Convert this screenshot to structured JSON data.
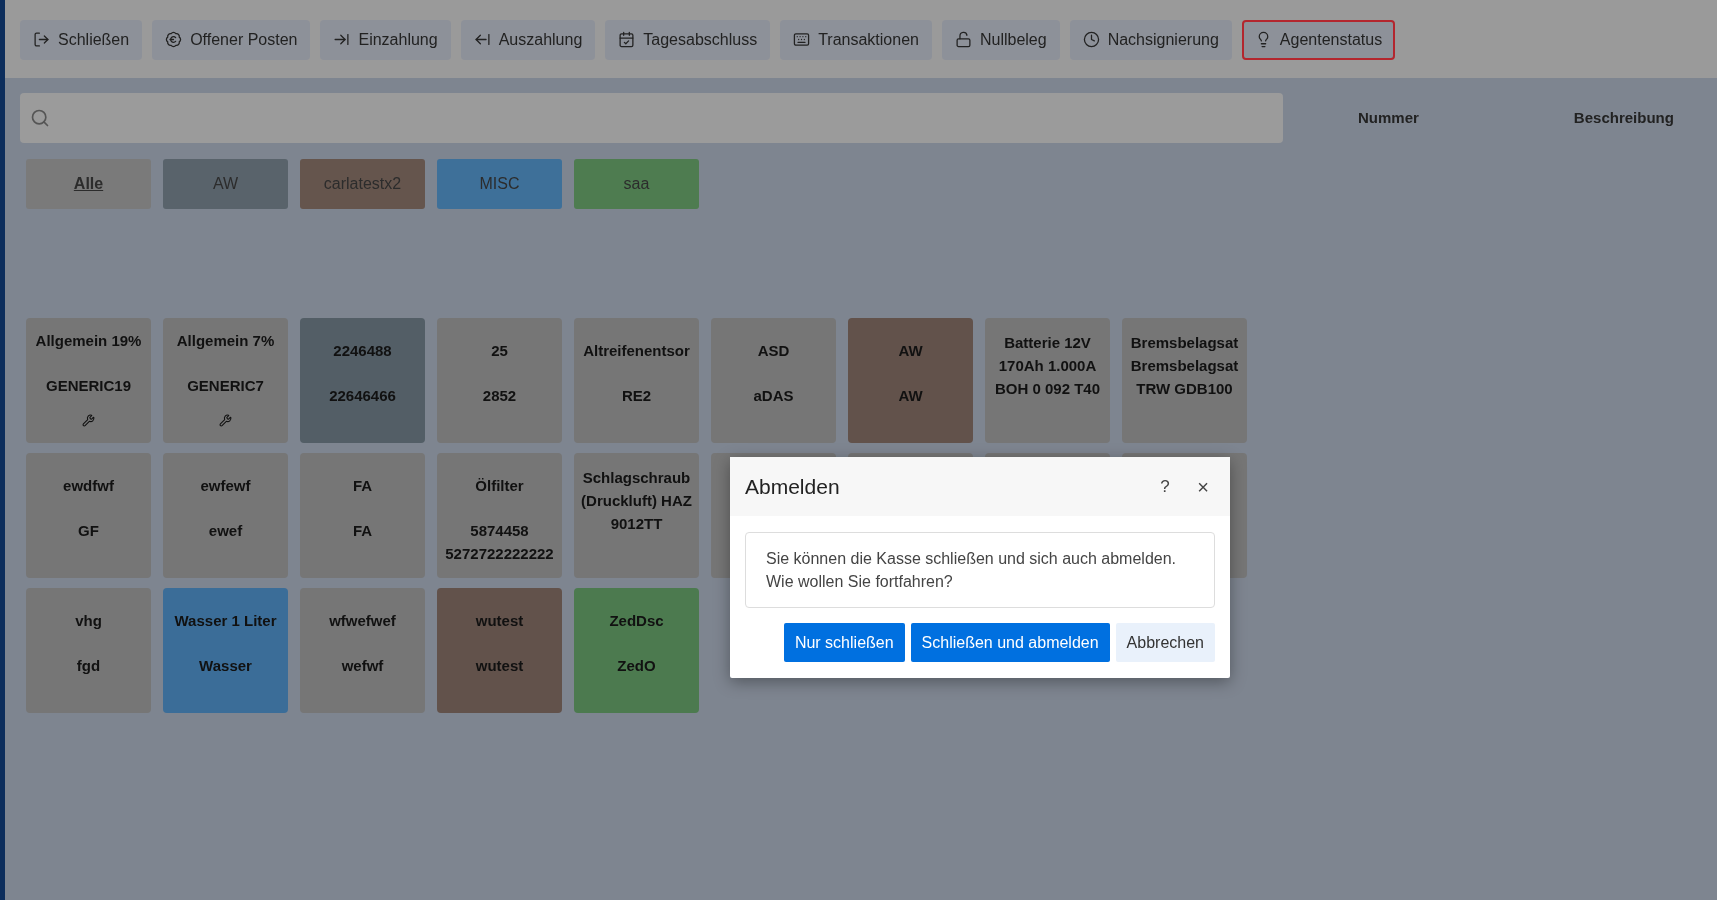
{
  "toolbar": [
    {
      "label": "Schließen",
      "selected": false
    },
    {
      "label": "Offener Posten",
      "selected": false
    },
    {
      "label": "Einzahlung",
      "selected": false
    },
    {
      "label": "Auszahlung",
      "selected": false
    },
    {
      "label": "Tagesabschluss",
      "selected": false
    },
    {
      "label": "Transaktionen",
      "selected": false
    },
    {
      "label": "Nullbeleg",
      "selected": false
    },
    {
      "label": "Nachsignierung",
      "selected": false
    },
    {
      "label": "Agentenstatus",
      "selected": true
    }
  ],
  "table": {
    "columns": [
      "Nummer",
      "Beschreibung"
    ]
  },
  "categories": [
    {
      "label": "Alle",
      "selected": true,
      "color": "#7a7a7a"
    },
    {
      "label": "AW",
      "selected": false,
      "color": "#59636b"
    },
    {
      "label": "carlatestx2",
      "selected": false,
      "color": "#65554d"
    },
    {
      "label": "MISC",
      "selected": false,
      "color": "#3e7099"
    },
    {
      "label": "saa",
      "selected": false,
      "color": "#4e7c50"
    }
  ],
  "tiles": [
    {
      "lines": [
        "Allgemein 19%",
        "GENERIC19"
      ],
      "tool": true,
      "color": "#767676"
    },
    {
      "lines": [
        "Allgemein 7%",
        "GENERIC7"
      ],
      "tool": true,
      "color": "#767676"
    },
    {
      "lines": [
        "2246488",
        "22646466"
      ],
      "tool": false,
      "color": "#535e66"
    },
    {
      "lines": [
        "25",
        "2852"
      ],
      "tool": false,
      "color": "#767676"
    },
    {
      "lines": [
        "Altreifenentsor",
        "RE2"
      ],
      "tool": false,
      "color": "#767676"
    },
    {
      "lines": [
        "ASD",
        "aDAS"
      ],
      "tool": false,
      "color": "#767676"
    },
    {
      "lines": [
        "AW",
        "AW"
      ],
      "tool": false,
      "color": "#62524b"
    },
    {
      "lines": [
        "Batterie 12V 170Ah 1.000A BOH 0 092 T40"
      ],
      "tool": false,
      "color": "#767676"
    },
    {
      "lines": [
        "Bremsbelagsat Bremsbelagsat TRW GDB100"
      ],
      "tool": false,
      "color": "#767676"
    },
    {
      "lines": [
        "ewdfwf",
        "GF"
      ],
      "tool": false,
      "color": "#767676"
    },
    {
      "lines": [
        "ewfewf",
        "ewef"
      ],
      "tool": false,
      "color": "#767676"
    },
    {
      "lines": [
        "FA",
        "FA"
      ],
      "tool": false,
      "color": "#767676"
    },
    {
      "lines": [
        "Ölfilter",
        "5874458 5272722222222"
      ],
      "tool": false,
      "color": "#767676"
    },
    {
      "lines": [
        "Schlagschraub (Druckluft) HAZ 9012TT"
      ],
      "tool": false,
      "color": "#767676"
    },
    {
      "color": "#767676"
    },
    {
      "color": "#767676"
    },
    {
      "color": "#767676"
    },
    {
      "color": "#767676"
    },
    {
      "lines": [
        "vhg",
        "fgd"
      ],
      "tool": false,
      "color": "#767676"
    },
    {
      "lines": [
        "Wasser 1 Liter",
        "Wasser"
      ],
      "tool": false,
      "color": "#3b6d98"
    },
    {
      "lines": [
        "wfwefwef",
        "wefwf"
      ],
      "tool": false,
      "color": "#767676"
    },
    {
      "lines": [
        "wutest",
        "wutest"
      ],
      "tool": false,
      "color": "#62524b"
    },
    {
      "lines": [
        "ZedDsc",
        "ZedO"
      ],
      "tool": false,
      "color": "#4c7a4f"
    }
  ],
  "dialog": {
    "title": "Abmelden",
    "help": "?",
    "close": "×",
    "message": "Sie können die Kasse schließen und sich auch abmelden. Wie wollen Sie fortfahren?",
    "buttons": [
      {
        "label": "Nur schließen",
        "kind": "primary"
      },
      {
        "label": "Schließen und abmelden",
        "kind": "primary"
      },
      {
        "label": "Abbrechen",
        "kind": "secondary"
      }
    ]
  }
}
